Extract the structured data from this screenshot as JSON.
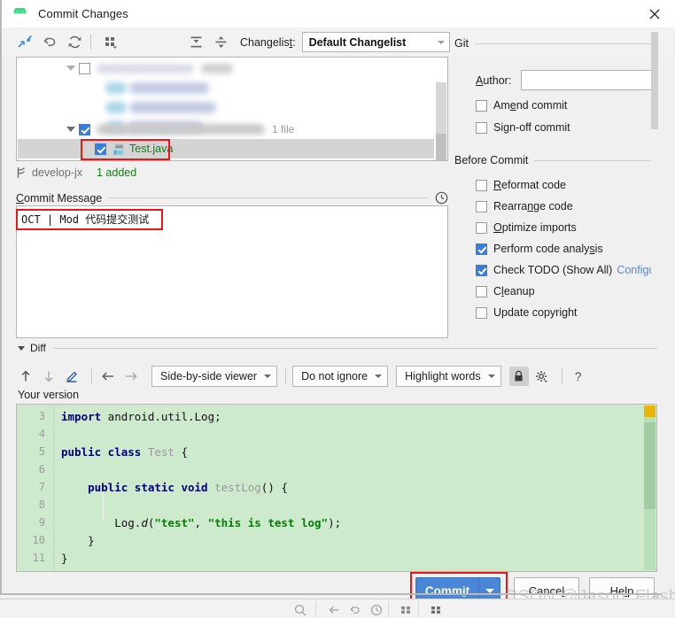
{
  "window": {
    "title": "Commit Changes",
    "app_icon": "android-icon",
    "close_icon": "close-icon"
  },
  "toolbar": {
    "icons": [
      {
        "name": "collapse-selection-icon",
        "glyph": "arrows"
      },
      {
        "name": "rollback-icon",
        "glyph": "undo"
      },
      {
        "name": "refresh-icon",
        "glyph": "refresh"
      },
      {
        "name": "group-by-icon",
        "glyph": "grid"
      },
      {
        "name": "expand-all-icon",
        "glyph": "expand"
      },
      {
        "name": "collapse-all-icon",
        "glyph": "collapse"
      }
    ],
    "changelist_label": "Changelis",
    "changelist_label_mnemonic": "t",
    "changelist_label_suffix": ":",
    "changelist_value": "Default Changelist"
  },
  "file_tree": {
    "group_file_count": "1 file",
    "selected_file": "Test.java",
    "selected_file_icon": "java-file-icon",
    "group_checked": true,
    "file_checked": true,
    "blurred_rows": 4
  },
  "status_line": {
    "branch_icon": "branch-icon",
    "branch": "develop-jx",
    "added": "1 added"
  },
  "commit_message": {
    "label_mnemonic": "C",
    "label": "ommit Message",
    "history_icon": "clock-icon",
    "value": "OCT | Mod 代码提交测试"
  },
  "git_panel": {
    "title": "Git",
    "author_label_mnemonic": "A",
    "author_label": "uthor:",
    "author_value": "",
    "options": [
      {
        "name": "amend-commit",
        "pre": "Am",
        "mn": "e",
        "post": "nd commit",
        "checked": false
      },
      {
        "name": "sign-off-commit",
        "pre": "Si",
        "mn": "g",
        "post": "n-off commit",
        "checked": false
      }
    ]
  },
  "before_commit": {
    "title": "Before Commit",
    "options": [
      {
        "name": "reformat-code",
        "pre": "",
        "mn": "R",
        "post": "eformat code",
        "checked": false
      },
      {
        "name": "rearrange-code",
        "pre": "Rearra",
        "mn": "n",
        "post": "ge code",
        "checked": false
      },
      {
        "name": "optimize-imports",
        "pre": "",
        "mn": "O",
        "post": "ptimize imports",
        "checked": false
      },
      {
        "name": "perform-code-analysis",
        "pre": "Perform code analy",
        "mn": "s",
        "post": "is",
        "checked": true
      },
      {
        "name": "check-todo",
        "pre": "Check TODO (Show All)",
        "mn": "",
        "post": "",
        "checked": true,
        "link": "Configure"
      },
      {
        "name": "cleanup",
        "pre": "C",
        "mn": "l",
        "post": "eanup",
        "checked": false
      },
      {
        "name": "update-copyright",
        "pre": "Update copyright",
        "mn": "",
        "post": "",
        "checked": false
      }
    ]
  },
  "diff": {
    "section_label": "Diff",
    "nav_icons": [
      {
        "name": "previous-difference-icon",
        "glyph": "↑"
      },
      {
        "name": "next-difference-icon",
        "glyph": "↓"
      },
      {
        "name": "edit-source-icon",
        "glyph": "pen"
      },
      {
        "name": "apply-left-icon",
        "glyph": "←"
      },
      {
        "name": "apply-right-icon",
        "glyph": "→"
      }
    ],
    "viewer_mode": "Side-by-side viewer",
    "ignore_mode": "Do not ignore",
    "highlight_mode": "Highlight words",
    "lock_icon": "lock-icon",
    "settings_icon": "gear-icon",
    "help_icon": "?",
    "pane_label": "Your version"
  },
  "code": {
    "lines": [
      {
        "num": "3",
        "tokens": [
          {
            "t": "import",
            "c": "kw"
          },
          {
            "t": " android.util.Log;",
            "c": "plain"
          }
        ]
      },
      {
        "num": "4",
        "tokens": []
      },
      {
        "num": "5",
        "tokens": [
          {
            "t": "public class",
            "c": "kw"
          },
          {
            "t": " ",
            "c": "plain"
          },
          {
            "t": "Test",
            "c": "cls"
          },
          {
            "t": " {",
            "c": "plain"
          }
        ]
      },
      {
        "num": "6",
        "tokens": []
      },
      {
        "num": "7",
        "tokens": [
          {
            "t": "    ",
            "c": "plain"
          },
          {
            "t": "public static void",
            "c": "kw"
          },
          {
            "t": " ",
            "c": "plain"
          },
          {
            "t": "testLog",
            "c": "mth"
          },
          {
            "t": "() {",
            "c": "plain"
          }
        ]
      },
      {
        "num": "8",
        "tokens": []
      },
      {
        "num": "9",
        "tokens": [
          {
            "t": "        Log.",
            "c": "plain"
          },
          {
            "t": "d",
            "c": "plain ital"
          },
          {
            "t": "(",
            "c": "plain"
          },
          {
            "t": "\"test\"",
            "c": "str"
          },
          {
            "t": ", ",
            "c": "plain"
          },
          {
            "t": "\"this is test log\"",
            "c": "str"
          },
          {
            "t": ");",
            "c": "plain"
          }
        ]
      },
      {
        "num": "10",
        "tokens": [
          {
            "t": "    }",
            "c": "plain"
          }
        ]
      },
      {
        "num": "11",
        "tokens": [
          {
            "t": "}",
            "c": "plain"
          }
        ]
      }
    ]
  },
  "buttons": {
    "commit_pre": "Comm",
    "commit_mn": "i",
    "commit_post": "t",
    "commit_dropdown_icon": "chevron-down-icon",
    "cancel_pre": "Cance",
    "cancel_mn": "l",
    "cancel_post": "",
    "help_pre": "He",
    "help_mn": "l",
    "help_post": "p"
  },
  "watermark": "CSDN @Jason_Flash",
  "annotations": {
    "boxes": [
      "selected-file-row",
      "commit-message-text",
      "commit-button"
    ],
    "color": "#f01414"
  }
}
